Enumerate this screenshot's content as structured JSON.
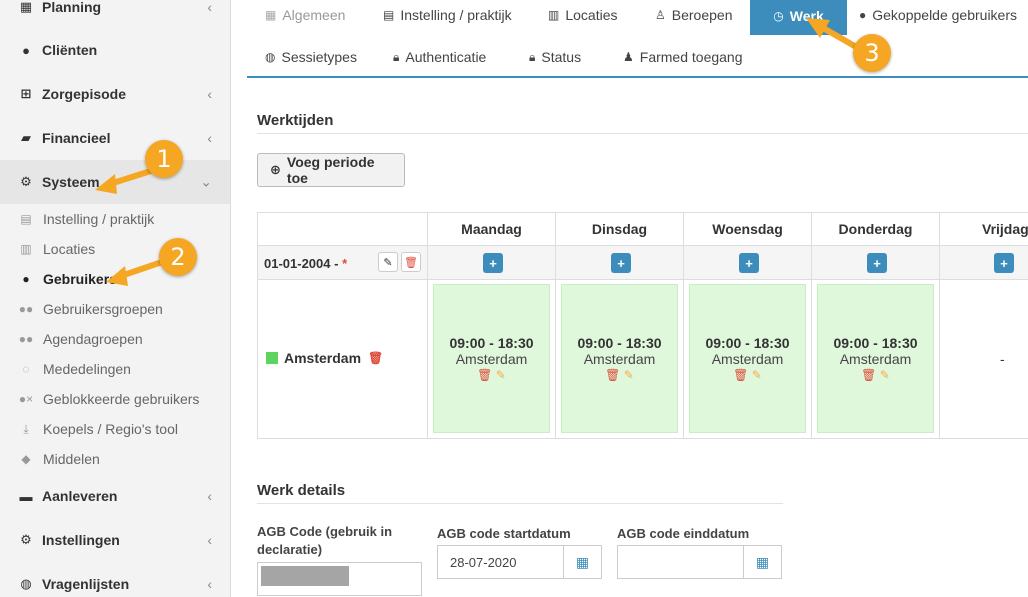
{
  "sidebar": {
    "items": [
      {
        "label": "Planning",
        "icon": "calendar-icon"
      },
      {
        "label": "Cliënten",
        "icon": "user-icon"
      },
      {
        "label": "Zorgepisode",
        "icon": "medkit-icon"
      },
      {
        "label": "Financieel",
        "icon": "book-icon"
      },
      {
        "label": "Systeem",
        "icon": "cogs-icon"
      },
      {
        "label": "Aanleveren",
        "icon": "truck-icon"
      },
      {
        "label": "Instellingen",
        "icon": "gear-icon"
      },
      {
        "label": "Vragenlijsten",
        "icon": "globe-icon"
      }
    ],
    "subitems": [
      {
        "label": "Instelling / praktijk",
        "icon": "clipboard-icon"
      },
      {
        "label": "Locaties",
        "icon": "map-icon"
      },
      {
        "label": "Gebruikers",
        "icon": "user-icon"
      },
      {
        "label": "Gebruikersgroepen",
        "icon": "users-icon"
      },
      {
        "label": "Agendagroepen",
        "icon": "users-icon"
      },
      {
        "label": "Mededelingen",
        "icon": "comments-icon"
      },
      {
        "label": "Geblokkeerde gebruikers",
        "icon": "user-times-icon"
      },
      {
        "label": "Koepels / Regio's tool",
        "icon": "download-icon"
      },
      {
        "label": "Middelen",
        "icon": "cubes-icon"
      }
    ]
  },
  "tabs": [
    {
      "label": "Algemeen",
      "icon": "table-icon"
    },
    {
      "label": "Instelling / praktijk",
      "icon": "clipboard-icon"
    },
    {
      "label": "Locaties",
      "icon": "map-icon"
    },
    {
      "label": "Beroepen",
      "icon": "person-icon"
    },
    {
      "label": "Werk",
      "icon": "clock-icon"
    },
    {
      "label": "Gekoppelde gebruikers",
      "icon": "user-icon"
    },
    {
      "label": "Sessietypes",
      "icon": "globe-icon"
    },
    {
      "label": "Authenticatie",
      "icon": "lock-icon"
    },
    {
      "label": "Status",
      "icon": "lock-icon"
    },
    {
      "label": "Farmed toegang",
      "icon": "user-md-icon"
    }
  ],
  "werktijden": {
    "title": "Werktijden",
    "add_button": "Voeg periode toe",
    "days": [
      "Maandag",
      "Dinsdag",
      "Woensdag",
      "Donderdag",
      "Vrijdag"
    ],
    "period_label": "01-01-2004 -",
    "period_required": "*",
    "location": "Amsterdam",
    "location_color": "#5fd35f",
    "slots": [
      {
        "time": "09:00 - 18:30",
        "location": "Amsterdam"
      },
      {
        "time": "09:00 - 18:30",
        "location": "Amsterdam"
      },
      {
        "time": "09:00 - 18:30",
        "location": "Amsterdam"
      },
      {
        "time": "09:00 - 18:30",
        "location": "Amsterdam"
      }
    ],
    "empty_marker": "-"
  },
  "werk_details": {
    "title": "Werk details",
    "agb_code_label": "AGB Code (gebruik in declaratie)",
    "agb_start_label": "AGB code startdatum",
    "agb_start_value": "28-07-2020",
    "agb_end_label": "AGB code einddatum",
    "agb_end_value": ""
  },
  "callouts": [
    "1",
    "2",
    "3"
  ],
  "colors": {
    "accent": "#3c8dbc",
    "callout": "#f5a623",
    "slot_bg": "#dff8dc",
    "danger": "#dd4b39"
  }
}
